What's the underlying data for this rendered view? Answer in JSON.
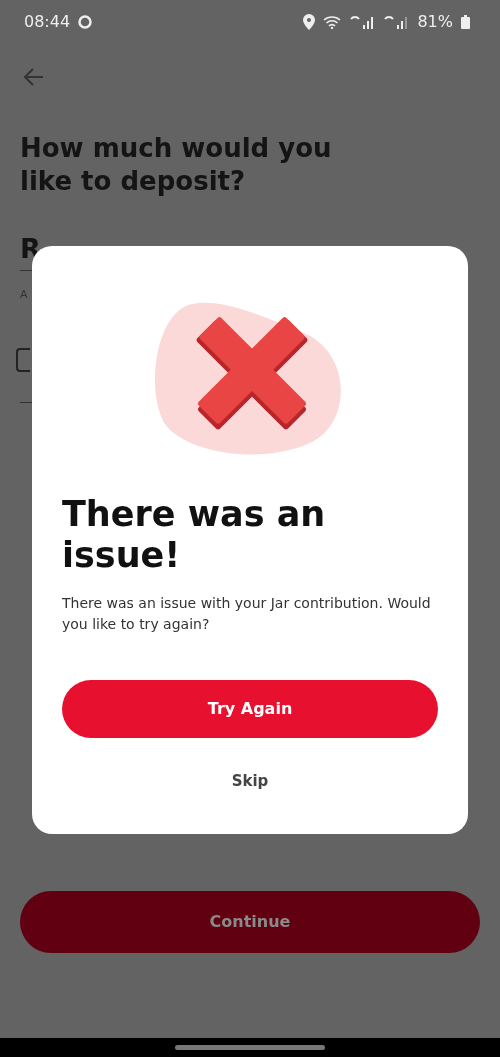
{
  "status_bar": {
    "time": "08:44",
    "battery": "81%"
  },
  "page": {
    "title": "How much would you like to deposit?",
    "amount": "R",
    "hint": "A",
    "continue_button": "Continue"
  },
  "dialog": {
    "title": "There was an issue!",
    "message": "There was an issue with your Jar contribution. Would you like to try again?",
    "primary_button": "Try Again",
    "secondary_button": "Skip"
  }
}
